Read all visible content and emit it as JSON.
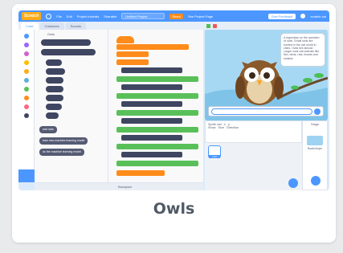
{
  "card": {
    "caption": "Owls"
  },
  "menubar": {
    "logo": "Scratch",
    "items": [
      "File",
      "Edit",
      "Project tutorials",
      "Sharable"
    ],
    "project_title": "Untitled Project",
    "share": "Share",
    "see_page": "See Project Page",
    "feedback": "Give Feedback",
    "user": "scratch-cat"
  },
  "editor": {
    "tabs": [
      "Code",
      "Costumes",
      "Sounds"
    ],
    "palette_title": "Owls",
    "palette_buttons": [
      "add data",
      "train new machine learning model",
      "do the machine learning model"
    ],
    "backpack": "Backpack"
  },
  "stage": {
    "speech": "A legendary on the question of owls. Small owls are hunted in the owl world in cities. Owls live almost. Larger owls eat animals like fish, birds, rats, lizards and snakes."
  },
  "sprite_info": {
    "sprite_label": "Sprite",
    "sprite_name": "owl",
    "x_label": "x",
    "y_label": "y",
    "show_label": "Show",
    "size_label": "Size",
    "direction_label": "Direction"
  },
  "sprite_list": {
    "sprites": [
      "Owl"
    ]
  },
  "stage_panel": {
    "title": "Stage",
    "backdrops_label": "Backdrops"
  },
  "colors": {
    "accent": "#4c97ff",
    "orange": "#ff8c1a",
    "green": "#59c059",
    "caption": "#505a66"
  }
}
